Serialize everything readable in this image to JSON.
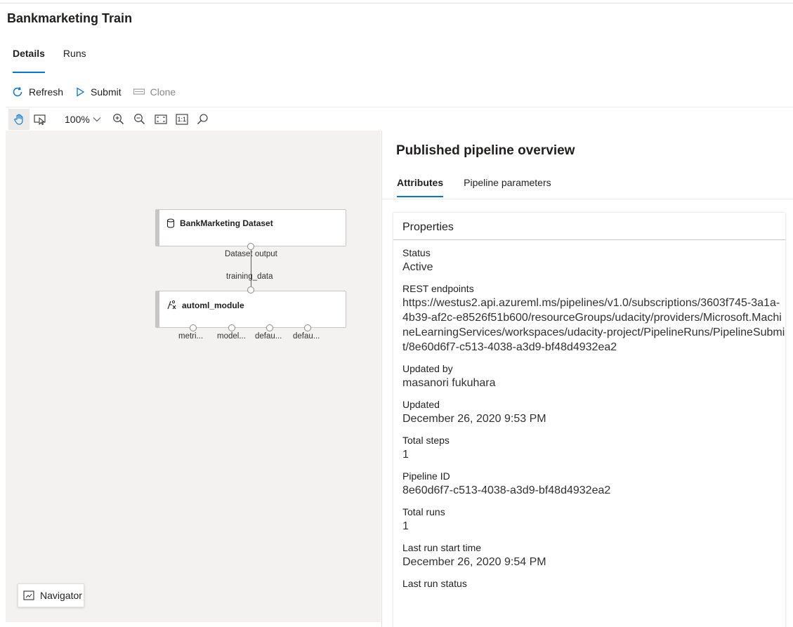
{
  "page": {
    "title": "Bankmarketing Train"
  },
  "tabs": [
    {
      "label": "Details"
    },
    {
      "label": "Runs"
    }
  ],
  "commands": {
    "refresh": "Refresh",
    "submit": "Submit",
    "clone": "Clone"
  },
  "canvas_toolbar": {
    "zoom": "100%",
    "icons": [
      "hand-icon",
      "select-icon",
      "zoom-in-icon",
      "zoom-out-icon",
      "fit-screen-icon",
      "actual-size-icon",
      "search-icon"
    ],
    "actual_size_label": "1:1"
  },
  "graph": {
    "dataset_node": {
      "title": "BankMarketing Dataset",
      "output_label": "Dataset output"
    },
    "module_node": {
      "title": "automl_module",
      "input_label": "training_data",
      "outputs": [
        "metri...",
        "model...",
        "defau...",
        "defau..."
      ]
    },
    "navigator": "Navigator"
  },
  "panel": {
    "title": "Published pipeline overview",
    "tabs": [
      "Attributes",
      "Pipeline parameters"
    ],
    "card_title": "Properties",
    "properties": [
      {
        "label": "Status",
        "value": "Active"
      },
      {
        "label": "REST endpoints",
        "value": "https://westus2.api.azureml.ms/pipelines/v1.0/subscriptions/3603f745-3a1a-4b39-af2c-e8526f51b600/resourceGroups/udacity/providers/Microsoft.MachineLearningServices/workspaces/udacity-project/PipelineRuns/PipelineSubmit/8e60d6f7-c513-4038-a3d9-bf48d4932ea2"
      },
      {
        "label": "Updated by",
        "value": "masanori fukuhara"
      },
      {
        "label": "Updated",
        "value": "December 26, 2020 9:53 PM"
      },
      {
        "label": "Total steps",
        "value": "1"
      },
      {
        "label": "Pipeline ID",
        "value": "8e60d6f7-c513-4038-a3d9-bf48d4932ea2"
      },
      {
        "label": "Total runs",
        "value": "1"
      },
      {
        "label": "Last run start time",
        "value": "December 26, 2020 9:54 PM"
      },
      {
        "label": "Last run status",
        "value": ""
      }
    ]
  },
  "colors": {
    "accent": "#0078d4",
    "canvas_bg": "#f3f2f1"
  }
}
